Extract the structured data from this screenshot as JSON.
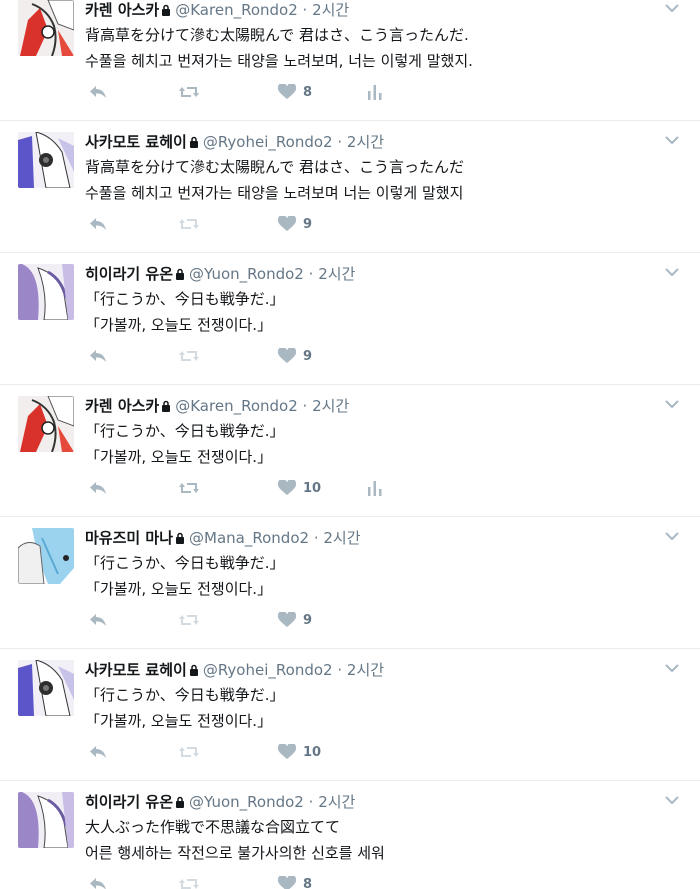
{
  "tweets": [
    {
      "name": "카렌 아스카",
      "handle": "@Karen_Rondo2",
      "dot": "·",
      "time": "2시간",
      "line1": "背高草を分けて滲む太陽睨んで 君はさ、こう言ったんだ.",
      "line2": "수풀을 헤치고 번져가는 태양을 노려보며, 너는 이렇게 말했지.",
      "likes": "8",
      "avatar": "karen",
      "analytics": true
    },
    {
      "name": "사카모토 료헤이",
      "handle": "@Ryohei_Rondo2",
      "dot": "·",
      "time": "2시간",
      "line1": "背高草を分けて滲む太陽睨んで 君はさ、こう言ったんだ",
      "line2": "수풀을 헤치고 번져가는 태양을 노려보며 너는 이렇게 말했지",
      "likes": "9",
      "avatar": "ryohei",
      "analytics": false
    },
    {
      "name": "히이라기 유온",
      "handle": "@Yuon_Rondo2",
      "dot": "·",
      "time": "2시간",
      "line1": "「行こうか、今日も戦争だ.」",
      "line2": "「가볼까, 오늘도 전쟁이다.」",
      "likes": "9",
      "avatar": "yuon",
      "analytics": false
    },
    {
      "name": "카렌 아스카",
      "handle": "@Karen_Rondo2",
      "dot": "·",
      "time": "2시간",
      "line1": "「行こうか、今日も戦争だ.」",
      "line2": "「가볼까, 오늘도 전쟁이다.」",
      "likes": "10",
      "avatar": "karen",
      "analytics": true
    },
    {
      "name": "마유즈미 마나",
      "handle": "@Mana_Rondo2",
      "dot": "·",
      "time": "2시간",
      "line1": "「行こうか、今日も戦争だ.」",
      "line2": "「가볼까, 오늘도 전쟁이다.」",
      "likes": "9",
      "avatar": "mana",
      "analytics": false
    },
    {
      "name": "사카모토 료헤이",
      "handle": "@Ryohei_Rondo2",
      "dot": "·",
      "time": "2시간",
      "line1": "「行こうか、今日も戦争だ.」",
      "line2": "「가볼까, 오늘도 전쟁이다.」",
      "likes": "10",
      "avatar": "ryohei",
      "analytics": false
    },
    {
      "name": "히이라기 유온",
      "handle": "@Yuon_Rondo2",
      "dot": "·",
      "time": "2시간",
      "line1": "大人ぶった作戦で不思議な合図立てて",
      "line2": "어른 행세하는 작전으로 불가사의한 신호를 세워",
      "likes": "8",
      "avatar": "yuon",
      "analytics": false
    }
  ],
  "colors": {
    "icon": "#aab8c2",
    "text": "#14171a",
    "muted": "#657786",
    "border": "#e6ecf0"
  }
}
